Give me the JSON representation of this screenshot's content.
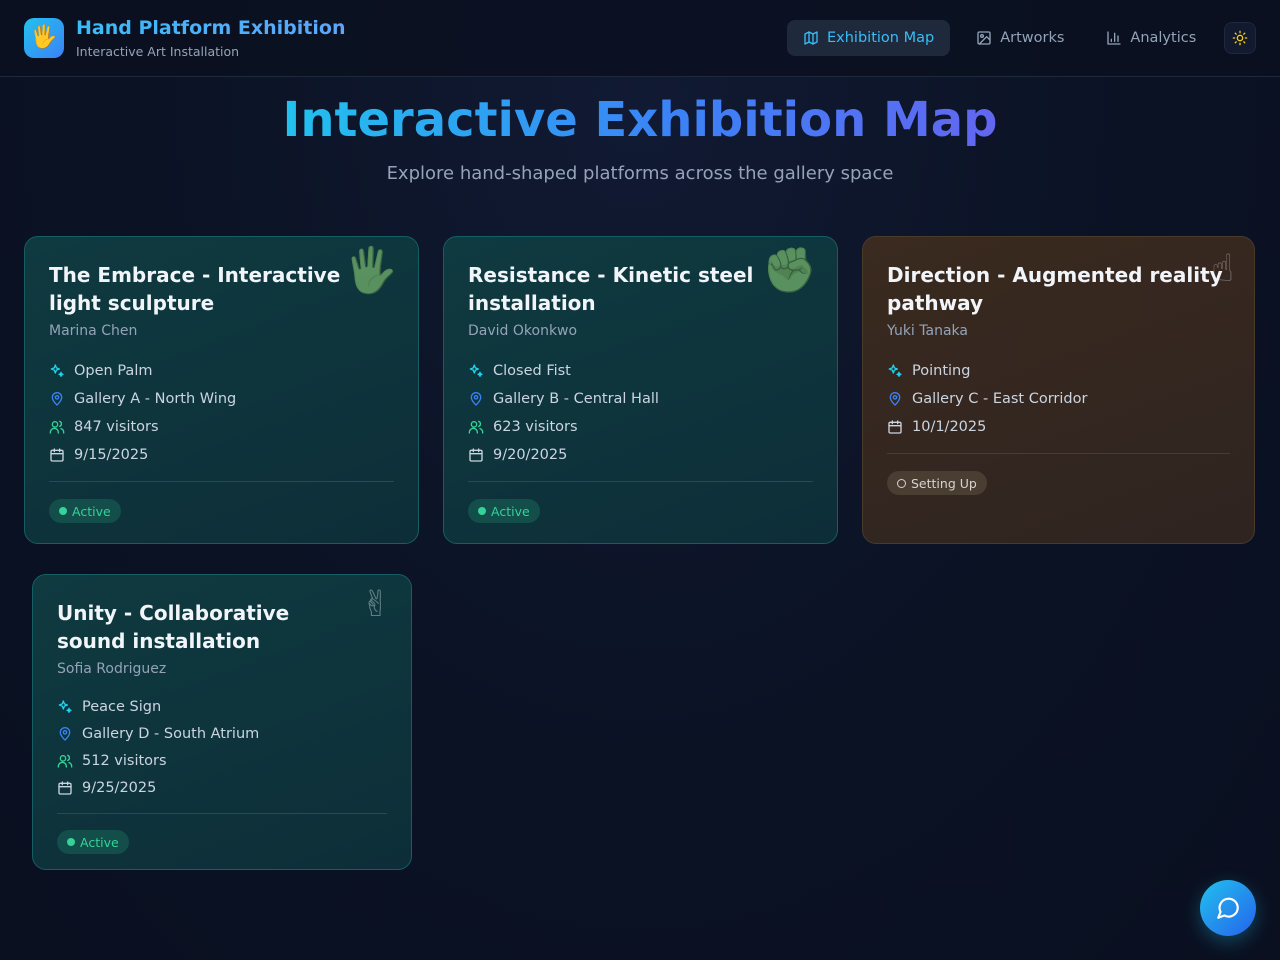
{
  "header": {
    "logo_glyph": "🖐",
    "title": "Hand Platform Exhibition",
    "subtitle": "Interactive Art Installation",
    "nav": [
      {
        "label": "Exhibition Map",
        "icon": "map-icon",
        "active": true
      },
      {
        "label": "Artworks",
        "icon": "image-icon",
        "active": false
      },
      {
        "label": "Analytics",
        "icon": "bar-chart-icon",
        "active": false
      }
    ],
    "theme_icon": "sun-icon"
  },
  "hero": {
    "title": "Interactive Exhibition Map",
    "subtitle": "Explore hand-shaped platforms across the gallery space"
  },
  "cards": [
    {
      "title": "The Embrace - Interactive light sculpture",
      "artist": "Marina Chen",
      "gesture": "Open Palm",
      "gesture_glyph": "🖐",
      "location": "Gallery A - North Wing",
      "visitors": "847 visitors",
      "date": "9/15/2025",
      "status": "Active"
    },
    {
      "title": "Resistance - Kinetic steel installation",
      "artist": "David Okonkwo",
      "gesture": "Closed Fist",
      "gesture_glyph": "✊",
      "location": "Gallery B - Central Hall",
      "visitors": "623 visitors",
      "date": "9/20/2025",
      "status": "Active"
    },
    {
      "title": "Direction - Augmented reality pathway",
      "artist": "Yuki Tanaka",
      "gesture": "Pointing",
      "gesture_glyph": "☝",
      "location": "Gallery C - East Corridor",
      "date": "10/1/2025",
      "status": "Setting Up"
    },
    {
      "title": "Unity - Collaborative sound installation",
      "artist": "Sofia Rodriguez",
      "gesture": "Peace Sign",
      "gesture_glyph": "✌",
      "location": "Gallery D - South Atrium",
      "visitors": "512 visitors",
      "date": "9/25/2025",
      "status": "Active"
    }
  ],
  "chat": {
    "icon": "message-circle-icon"
  },
  "colors": {
    "accent": "#38bdf8",
    "active": "#34d399",
    "card_bg": "#0f3a40",
    "setup_bg": "#3a2a1f"
  }
}
